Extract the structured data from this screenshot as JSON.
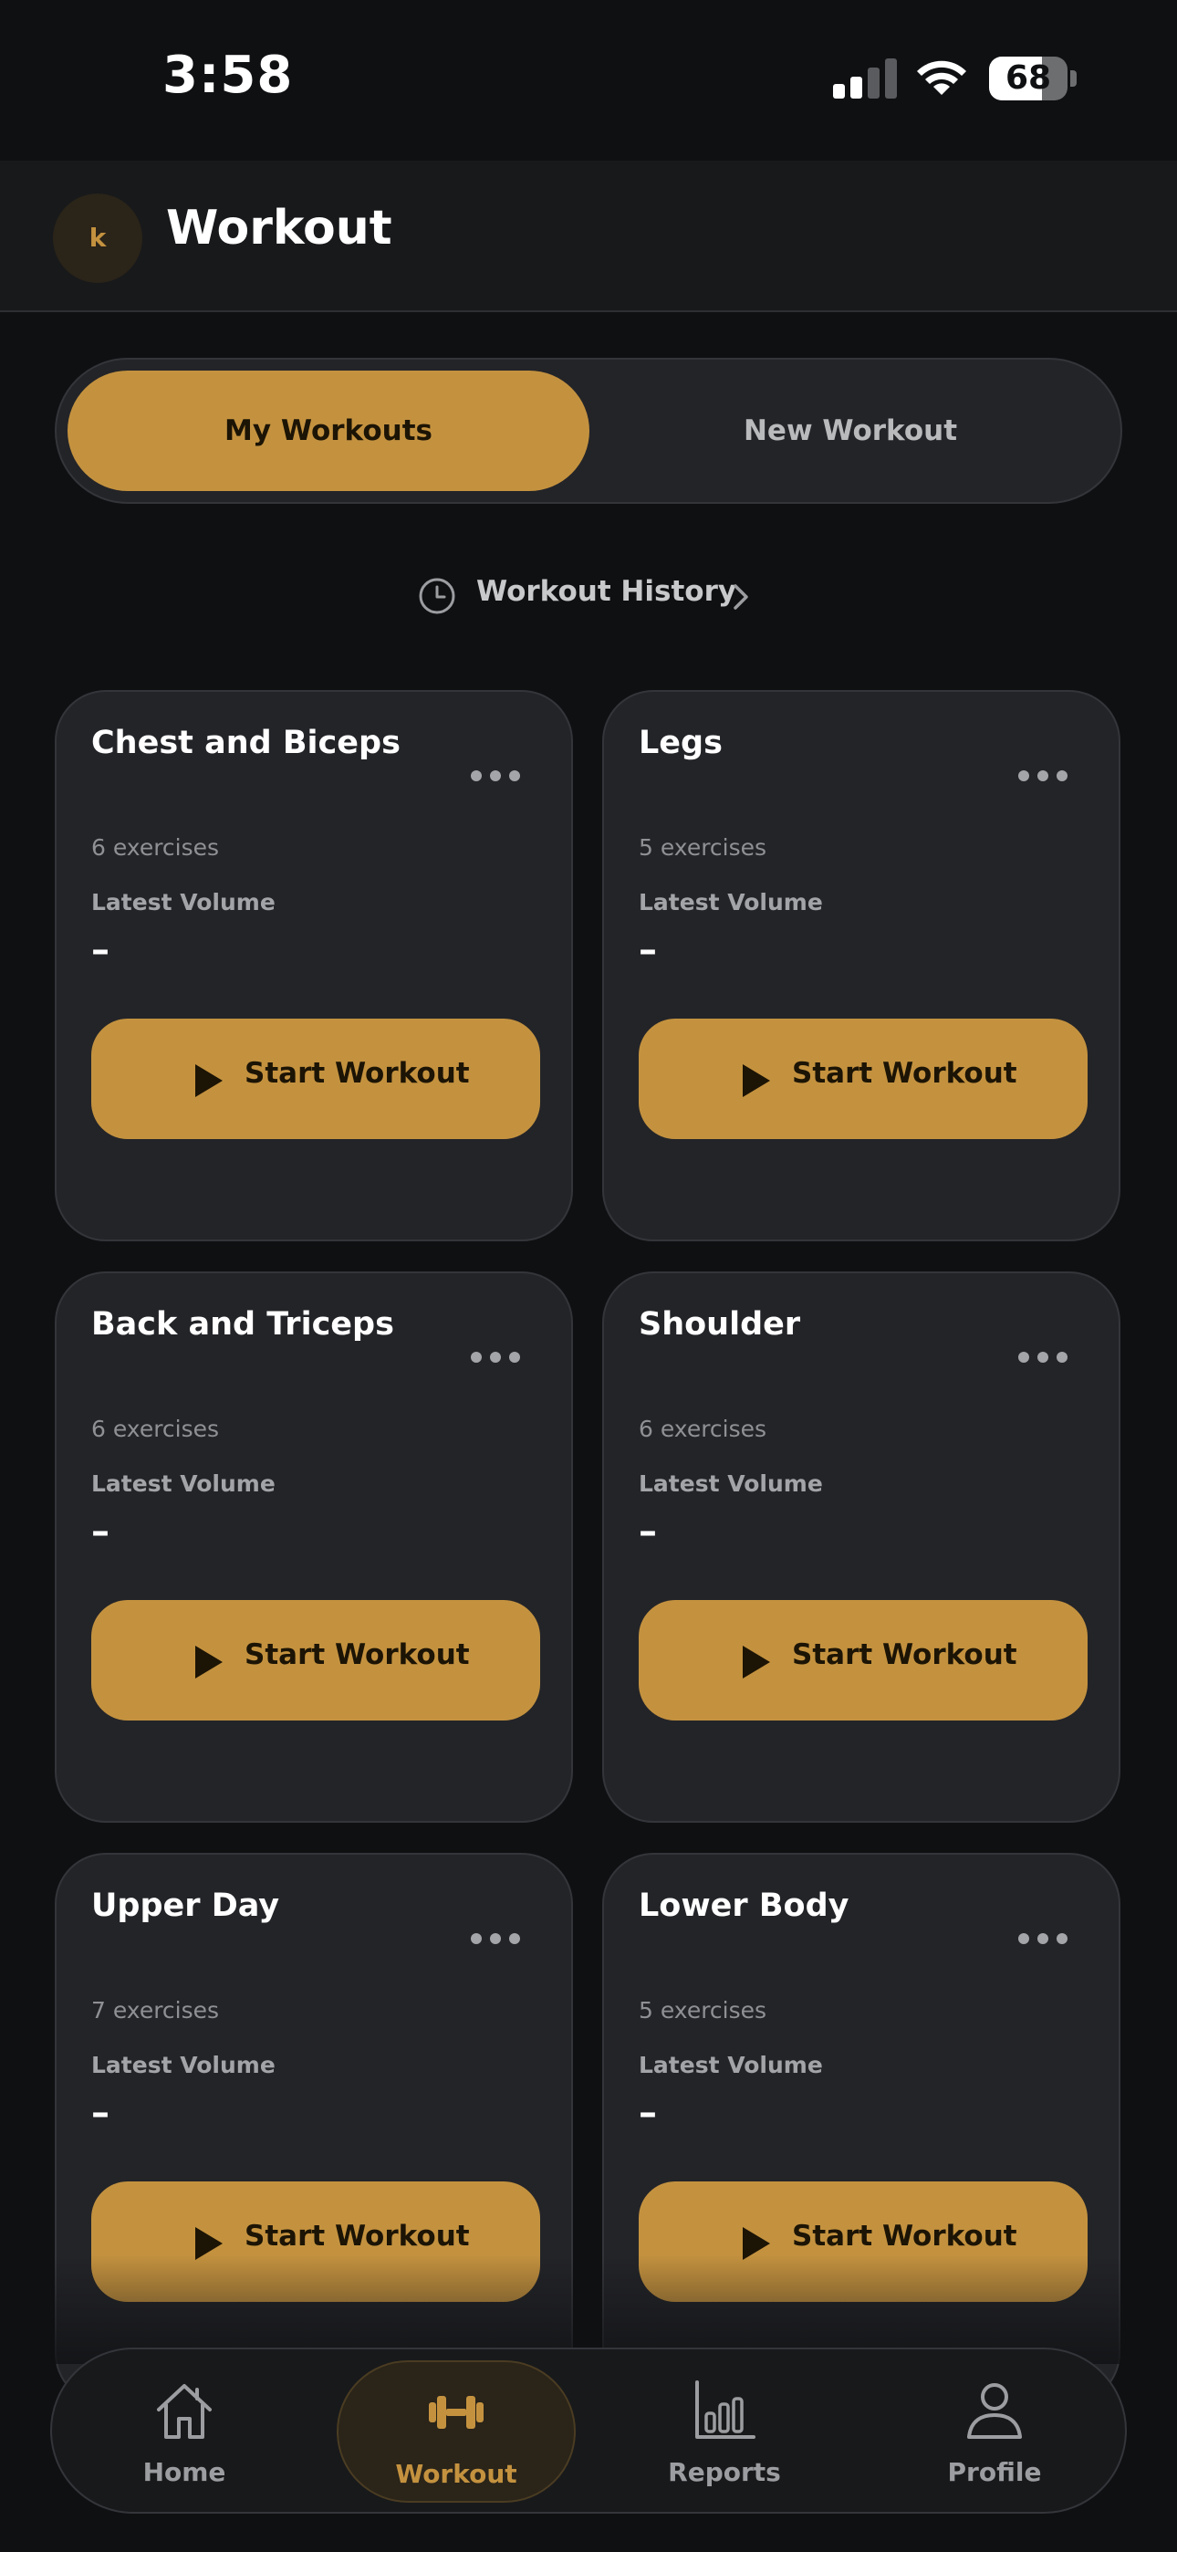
{
  "status_bar": {
    "time": "3:58",
    "battery": "68",
    "battery_level": 0.68,
    "signal_bars_active": 2
  },
  "header": {
    "avatar_initial": "k",
    "title": "Workout"
  },
  "tabs": {
    "active": "My Workouts",
    "inactive": "New Workout"
  },
  "history_link": {
    "label": "Workout History",
    "icon": "clock-icon"
  },
  "cards": [
    {
      "title": "Chest and Biceps",
      "exercises": "6 exercises",
      "volume_label": "Latest Volume",
      "volume_value": "–",
      "button": "Start Workout"
    },
    {
      "title": "Legs",
      "exercises": "5 exercises",
      "volume_label": "Latest Volume",
      "volume_value": "–",
      "button": "Start Workout"
    },
    {
      "title": "Back and Triceps",
      "exercises": "6 exercises",
      "volume_label": "Latest Volume",
      "volume_value": "–",
      "button": "Start Workout"
    },
    {
      "title": "Shoulder",
      "exercises": "6 exercises",
      "volume_label": "Latest Volume",
      "volume_value": "–",
      "button": "Start Workout"
    },
    {
      "title": "Upper Day",
      "exercises": "7 exercises",
      "volume_label": "Latest Volume",
      "volume_value": "–",
      "button": "Start Workout"
    },
    {
      "title": "Lower Body",
      "exercises": "5 exercises",
      "volume_label": "Latest Volume",
      "volume_value": "–",
      "button": "Start Workout"
    }
  ],
  "nav": [
    {
      "label": "Home",
      "icon": "home-icon",
      "active": false
    },
    {
      "label": "Workout",
      "icon": "dumbbell-icon",
      "active": true
    },
    {
      "label": "Reports",
      "icon": "bar-chart-icon",
      "active": false
    },
    {
      "label": "Profile",
      "icon": "person-icon",
      "active": false
    }
  ],
  "colors": {
    "accent": "#c4923f",
    "background": "#0f1012",
    "card": "#232428",
    "text_muted": "#8f9094"
  }
}
